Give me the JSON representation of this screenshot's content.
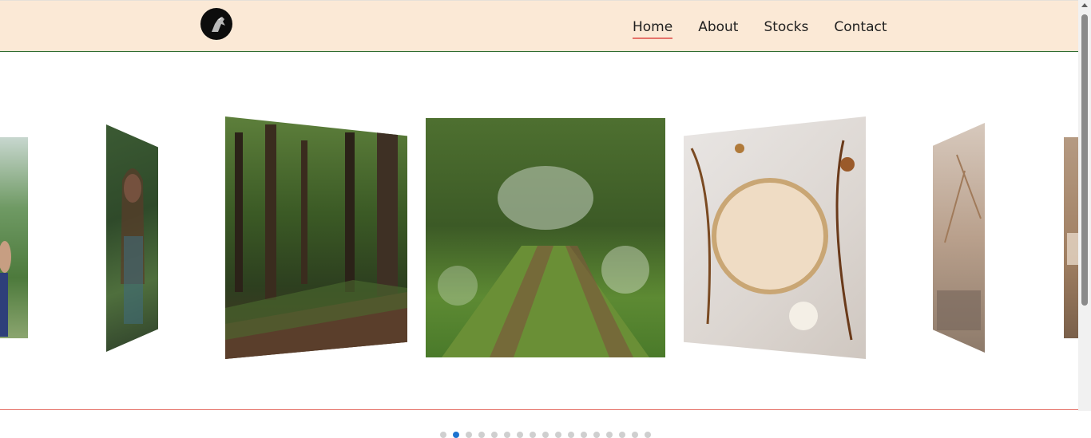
{
  "nav": {
    "items": [
      {
        "label": "Home",
        "active": true
      },
      {
        "label": "About",
        "active": false
      },
      {
        "label": "Stocks",
        "active": false
      },
      {
        "label": "Contact",
        "active": false
      }
    ]
  },
  "carousel": {
    "slides": [
      {
        "subject": "person portrait in greenery"
      },
      {
        "subject": "woman among leaves"
      },
      {
        "subject": "forest path with tall trees"
      },
      {
        "subject": "grassy track through woodland"
      },
      {
        "subject": "round mirror with dried flowers"
      },
      {
        "subject": "shadowed interior with plant"
      },
      {
        "subject": "warm-toned interior"
      }
    ],
    "dot_count": 17,
    "active_dot": 1
  },
  "colors": {
    "header_bg": "#fbe9d6",
    "nav_underline": "#e5736a",
    "active_dot": "#1e74d0",
    "inactive_dot": "#cfcfcf"
  }
}
